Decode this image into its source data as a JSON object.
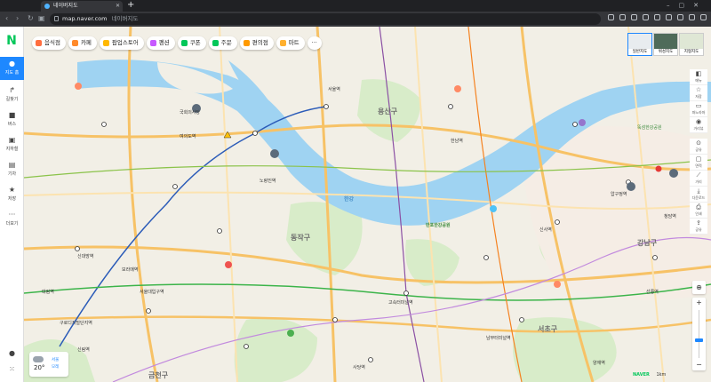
{
  "browser": {
    "tab_title": "네이버지도",
    "url_domain": "map.naver.com",
    "url_title": "네이버지도"
  },
  "leftnav": {
    "items": [
      {
        "label": "지도 홈",
        "icon": "map-pin-icon"
      },
      {
        "label": "길찾기",
        "icon": "route-icon"
      },
      {
        "label": "버스",
        "icon": "bus-icon"
      },
      {
        "label": "지하철",
        "icon": "subway-icon"
      },
      {
        "label": "기차",
        "icon": "train-icon"
      },
      {
        "label": "저장",
        "icon": "star-icon"
      },
      {
        "label": "더보기",
        "icon": "more-icon"
      }
    ]
  },
  "chips": [
    {
      "label": "음식점",
      "color": "#ff6e3f"
    },
    {
      "label": "카페",
      "color": "#ff8a2a"
    },
    {
      "label": "팝업스토어",
      "color": "#ffb800"
    },
    {
      "label": "펜션",
      "color": "#c659ff"
    },
    {
      "label": "쿠폰",
      "color": "#03c75a"
    },
    {
      "label": "주문",
      "color": "#03c75a"
    },
    {
      "label": "편의점",
      "color": "#ff9a00"
    },
    {
      "label": "마트",
      "color": "#ffb02e"
    }
  ],
  "chips_more": "···",
  "maptypes": [
    {
      "label": "일반지도"
    },
    {
      "label": "위성지도"
    },
    {
      "label": "지형지도"
    }
  ],
  "right_tools": [
    {
      "label": "메뉴",
      "icon": "layers-icon"
    },
    {
      "label": "저장",
      "icon": "star-icon"
    },
    {
      "label": "파노라마",
      "icon": "panorama-icon"
    },
    {
      "label": "거리뷰",
      "icon": "streetview-icon"
    },
    {
      "label": "공유",
      "icon": "share-icon"
    },
    {
      "label": "면적",
      "icon": "area-icon"
    },
    {
      "label": "거리",
      "icon": "ruler-icon"
    },
    {
      "label": "다운로드",
      "icon": "download-icon"
    },
    {
      "label": "인쇄",
      "icon": "print-icon"
    },
    {
      "label": "공유",
      "icon": "share-icon"
    }
  ],
  "weather": {
    "temp": "20°",
    "label1": "서울",
    "label2": "모레",
    "icon": "cloud-icon"
  },
  "scale": {
    "brand": "NAVER",
    "text": "1km"
  },
  "map_labels": [
    {
      "text": "용산구",
      "kind": "district"
    },
    {
      "text": "강남구",
      "kind": "district"
    },
    {
      "text": "서초구",
      "kind": "district"
    },
    {
      "text": "동작구",
      "kind": "district"
    },
    {
      "text": "한강",
      "kind": "river"
    },
    {
      "text": "반포한강공원",
      "kind": "park"
    },
    {
      "text": "금천구",
      "kind": "district"
    },
    {
      "text": "여의도역",
      "kind": "station"
    },
    {
      "text": "노량진역",
      "kind": "station"
    },
    {
      "text": "신대방역",
      "kind": "station"
    },
    {
      "text": "보라매역",
      "kind": "station"
    },
    {
      "text": "서울역",
      "kind": "station"
    },
    {
      "text": "고속터미널역",
      "kind": "station"
    },
    {
      "text": "압구정역",
      "kind": "station"
    },
    {
      "text": "신사역",
      "kind": "station"
    },
    {
      "text": "사당역",
      "kind": "station"
    },
    {
      "text": "남부터미널역",
      "kind": "station"
    },
    {
      "text": "국회의사당",
      "kind": "landmark"
    },
    {
      "text": "서울대입구역",
      "kind": "station"
    },
    {
      "text": "구로디지털단지역",
      "kind": "station"
    },
    {
      "text": "양재역",
      "kind": "station"
    },
    {
      "text": "선릉역",
      "kind": "station"
    },
    {
      "text": "청담역",
      "kind": "station"
    },
    {
      "text": "뚝섬한강공원",
      "kind": "park"
    },
    {
      "text": "한남역",
      "kind": "station"
    },
    {
      "text": "신림역",
      "kind": "station"
    },
    {
      "text": "대림역",
      "kind": "station"
    }
  ]
}
